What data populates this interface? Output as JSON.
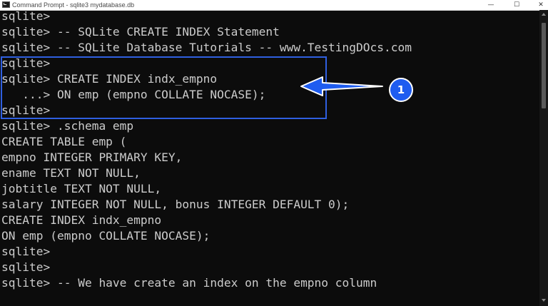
{
  "window": {
    "title": "Command Prompt - sqlite3  mydatabase.db",
    "minimize_glyph": "—",
    "maximize_glyph": "☐",
    "close_glyph": "✕"
  },
  "terminal": {
    "lines": [
      "sqlite>",
      "sqlite> -- SQLite CREATE INDEX Statement",
      "sqlite> -- SQLite Database Tutorials -- www.TestingDOcs.com",
      "sqlite>",
      "sqlite> CREATE INDEX indx_empno",
      "   ...> ON emp (empno COLLATE NOCASE);",
      "sqlite>",
      "sqlite> .schema emp",
      "CREATE TABLE emp (",
      "empno INTEGER PRIMARY KEY,",
      "ename TEXT NOT NULL,",
      "jobtitle TEXT NOT NULL,",
      "salary INTEGER NOT NULL, bonus INTEGER DEFAULT 0);",
      "CREATE INDEX indx_empno",
      "ON emp (empno COLLATE NOCASE);",
      "sqlite>",
      "sqlite>",
      "sqlite> -- We have create an index on the empno column"
    ]
  },
  "annotation": {
    "badge_label": "1",
    "box_color": "#2f5fe0",
    "badge_color": "#1e5cf0"
  },
  "icons": {
    "app": "console-icon",
    "arrow": "left-arrow-icon"
  }
}
